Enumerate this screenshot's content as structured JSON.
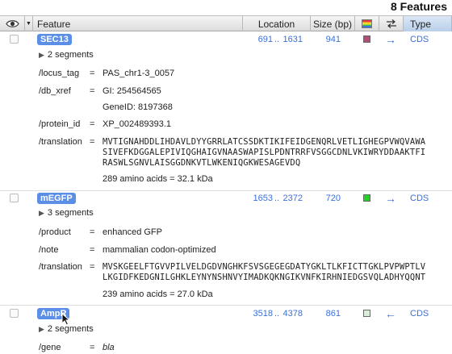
{
  "title_count": "8 Features",
  "header": {
    "feature": "Feature",
    "location": "Location",
    "size": "Size (bp)",
    "type": "Type",
    "eye_icon": "eye-icon",
    "color_icon": "rainbow-color-icon",
    "strand_icon": "swap-arrows-icon"
  },
  "features": [
    {
      "name": "SEC13",
      "start": "691",
      "dots": "..",
      "end": "1631",
      "size": "941",
      "color": "#b34d77",
      "strand": "→",
      "type": "CDS",
      "segments": "2 segments",
      "qualifiers": [
        {
          "key": "/locus_tag",
          "eq": "=",
          "value": "PAS_chr1-3_0057"
        },
        {
          "key": "/db_xref",
          "eq": "=",
          "value": "GI: 254564565"
        },
        {
          "key": "",
          "eq": "",
          "value": "GeneID: 8197368"
        },
        {
          "key": "/protein_id",
          "eq": "=",
          "value": "XP_002489393.1"
        },
        {
          "key": "/translation",
          "eq": "=",
          "value": "MVTIGNAHDDLIHDAVLDYYGRRLATCSSDKTIKIFEIDGENQRLVETLIGHEGPVWQVAWA"
        },
        {
          "key": "",
          "eq": "",
          "value": "SIVEFKDGGALEPIVIQGHAIGVNAASWAPISLPDNTRRFVSGGCDNLVKIWRYDDAAKTFI"
        },
        {
          "key": "",
          "eq": "",
          "value": "RASWLSGNVLAISGGDNKVTLWKENIQGKWESAGEVDQ"
        },
        {
          "key": "",
          "eq": "",
          "value": "289 amino acids  =  32.1 kDa"
        }
      ]
    },
    {
      "name": "mEGFP",
      "start": "1653",
      "dots": "..",
      "end": "2372",
      "size": "720",
      "color": "#22d422",
      "strand": "→",
      "type": "CDS",
      "segments": "3 segments",
      "qualifiers": [
        {
          "key": "/product",
          "eq": "=",
          "value": "enhanced GFP"
        },
        {
          "key": "/note",
          "eq": "=",
          "value": "mammalian codon-optimized"
        },
        {
          "key": "/translation",
          "eq": "=",
          "value": "MVSKGEELFTGVVPILVELDGDVNGHKFSVSGEGEGDATYGKLTLKFICTTGKLPVPWPTLV"
        },
        {
          "key": "",
          "eq": "",
          "value": "LKGIDFKEDGNILGHKLEYNYNSHNVYIMADKQKNGIKVNFKIRHNIEDGSVQLADHYQQNT"
        },
        {
          "key": "",
          "eq": "",
          "value": "239 amino acids  =  27.0 kDa"
        }
      ]
    },
    {
      "name": "AmpR",
      "start": "3518",
      "dots": "..",
      "end": "4378",
      "size": "861",
      "color": "#d8f0d8",
      "strand": "←",
      "type": "CDS",
      "segments": "2 segments",
      "qualifiers": [
        {
          "key": "/gene",
          "eq": "=",
          "value": "bla"
        }
      ]
    }
  ]
}
